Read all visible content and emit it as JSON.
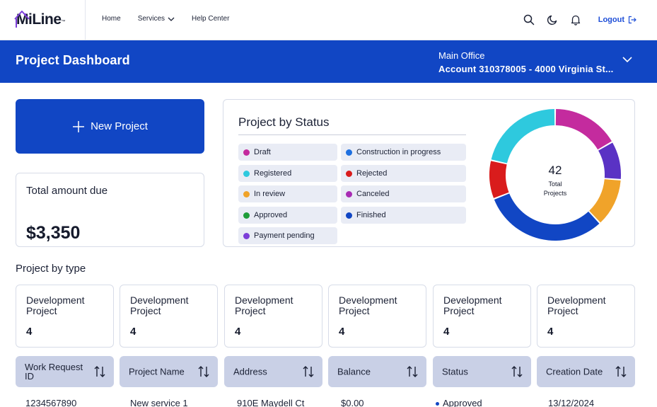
{
  "brand": {
    "name": "MiLine",
    "tm": "™"
  },
  "nav": {
    "links": [
      {
        "label": "Home",
        "has_dropdown": false
      },
      {
        "label": "Services",
        "has_dropdown": true
      },
      {
        "label": "Help Center",
        "has_dropdown": false
      }
    ],
    "icons": [
      "search-icon",
      "moon-icon",
      "bell-icon"
    ],
    "logout_label": "Logout"
  },
  "header": {
    "title": "Project Dashboard",
    "account_line1": "Main Office",
    "account_line2": "Account 310378005 - 4000 Virginia St..."
  },
  "actions": {
    "new_project_label": "New Project"
  },
  "summary": {
    "amount_label": "Total amount due",
    "amount_value": "$3,350"
  },
  "status_panel": {
    "title": "Project by Status",
    "legend": [
      {
        "label": "Draft",
        "color": "#c42b9e"
      },
      {
        "label": "Construction in progress",
        "color": "#1d6fe0"
      },
      {
        "label": "Registered",
        "color": "#2ec9de"
      },
      {
        "label": "Rejected",
        "color": "#d91c1c"
      },
      {
        "label": "In review",
        "color": "#f0a32a"
      },
      {
        "label": "Canceled",
        "color": "#a82cb4"
      },
      {
        "label": "Approved",
        "color": "#1f9d3a"
      },
      {
        "label": "Finished",
        "color": "#1146c4"
      },
      {
        "label": "Payment pending",
        "color": "#7c3ed8"
      }
    ],
    "total": "42",
    "total_label_line1": "Total",
    "total_label_line2": "Projects"
  },
  "chart_data": {
    "type": "pie",
    "donut": true,
    "slices": [
      {
        "label": "Draft",
        "value": 7,
        "color": "#c42b9e"
      },
      {
        "label": "Payment pending",
        "value": 4,
        "color": "#5a32c4"
      },
      {
        "label": "In review",
        "value": 5,
        "color": "#f0a32a"
      },
      {
        "label": "Finished",
        "value": 13,
        "color": "#1146c4"
      },
      {
        "label": "Rejected",
        "value": 4,
        "color": "#d91c1c"
      },
      {
        "label": "Registered",
        "value": 9,
        "color": "#2ec9de"
      }
    ],
    "center_value": "42",
    "center_label": "Total Projects"
  },
  "by_type": {
    "title": "Project by type",
    "cards": [
      {
        "name": "Development Project",
        "count": "4"
      },
      {
        "name": "Development Project",
        "count": "4"
      },
      {
        "name": "Development Project",
        "count": "4"
      },
      {
        "name": "Development Project",
        "count": "4"
      },
      {
        "name": "Development Project",
        "count": "4"
      },
      {
        "name": "Development Project",
        "count": "4"
      }
    ]
  },
  "table": {
    "columns": [
      "Work Request ID",
      "Project Name",
      "Address",
      "Balance",
      "Status",
      "Creation Date"
    ],
    "rows": [
      [
        "1234567890",
        "New service 1",
        "910E Maydell Ct",
        "$0.00",
        "Approved",
        "13/12/2024"
      ]
    ]
  }
}
